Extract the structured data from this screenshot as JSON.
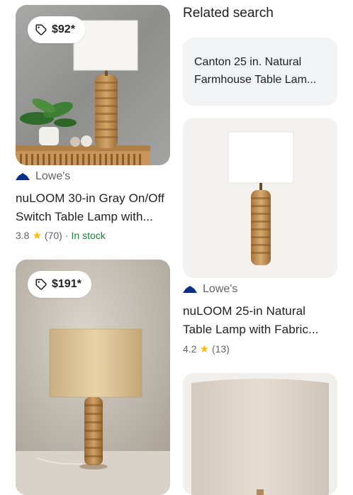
{
  "left_column": {
    "products": [
      {
        "price": "$92*",
        "merchant": "Lowe's",
        "title_line1": "nuLOOM 30-in Gray On/Off",
        "title_line2": "Switch Table Lamp with...",
        "rating": "3.8",
        "reviews": "(70)",
        "separator": "·",
        "availability": "In stock"
      },
      {
        "price": "$191*"
      }
    ]
  },
  "right_column": {
    "related_heading": "Related search",
    "related_query_line1": "Canton 25 in. Natural",
    "related_query_line2": "Farmhouse Table Lam...",
    "products": [
      {
        "merchant": "Lowe's",
        "title_line1": "nuLOOM 25-in Natural",
        "title_line2": "Table Lamp with Fabric...",
        "rating": "4.2",
        "reviews": "(13)"
      }
    ]
  },
  "colors": {
    "price_chip_bg": "#ffffff",
    "related_chip_bg": "#f1f3f4",
    "stock_green": "#188038",
    "star_yellow": "#fbbc04",
    "lowes_blue": "#0b2f8a"
  },
  "icons": [
    "price-tag-icon",
    "lowes-logo-icon",
    "star-icon"
  ]
}
